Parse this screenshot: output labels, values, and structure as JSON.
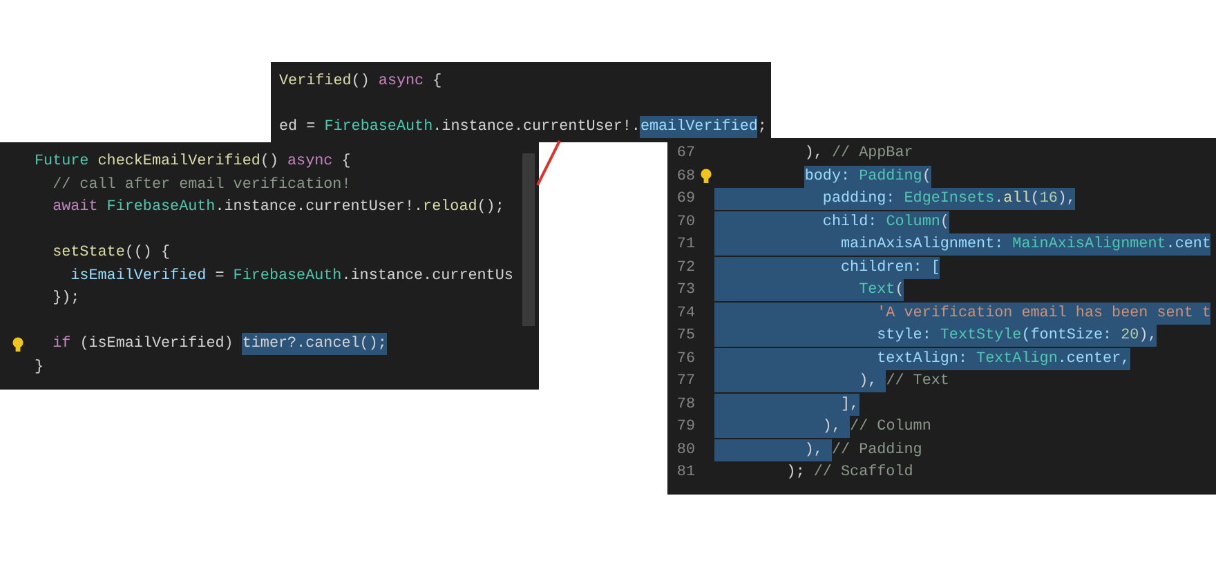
{
  "panels": [
    {
      "kind": "snippet",
      "lines": [
        {
          "bulb": false,
          "tokens": [
            {
              "t": "Verified",
              "kind": "fn",
              "selected": false
            },
            {
              "t": "() ",
              "kind": "plain",
              "selected": false
            },
            {
              "t": "async",
              "kind": "kw",
              "selected": false
            },
            {
              "t": " {",
              "kind": "plain",
              "selected": false
            }
          ]
        },
        {
          "bulb": false
        },
        {
          "bulb": false,
          "tokens": [
            {
              "t": "ed = ",
              "kind": "plain",
              "selected": false
            },
            {
              "t": "FirebaseAuth",
              "kind": "type",
              "selected": false
            },
            {
              "t": ".instance.currentUser!.",
              "kind": "plain",
              "selected": false
            },
            {
              "t": "emailVerified",
              "kind": "var",
              "selected": true
            },
            {
              "t": ";",
              "kind": "plain",
              "selected": false
            }
          ]
        }
      ]
    },
    {
      "kind": "snippet",
      "scrollbar": true,
      "lines": [
        {
          "bulb": false,
          "tokens": [
            {
              "t": "Future",
              "kind": "type",
              "selected": false
            },
            {
              "t": " checkEmailVerified",
              "kind": "fn",
              "selected": false
            },
            {
              "t": "() ",
              "kind": "plain",
              "selected": false
            },
            {
              "t": "async",
              "kind": "kw",
              "selected": false
            },
            {
              "t": " {",
              "kind": "plain",
              "selected": false
            }
          ]
        },
        {
          "bulb": false,
          "tokens": [
            {
              "t": "  // call after email verification!",
              "kind": "comment",
              "selected": false
            }
          ]
        },
        {
          "bulb": false,
          "tokens": [
            {
              "t": "  await",
              "kind": "kw",
              "selected": false
            },
            {
              "t": " FirebaseAuth",
              "kind": "type",
              "selected": false
            },
            {
              "t": ".instance.currentUser!.",
              "kind": "plain",
              "selected": false
            },
            {
              "t": "reload",
              "kind": "fn",
              "selected": false
            },
            {
              "t": "();",
              "kind": "plain",
              "selected": false
            }
          ]
        },
        {
          "bulb": false
        },
        {
          "bulb": false,
          "tokens": [
            {
              "t": "  setState",
              "kind": "fn",
              "selected": false
            },
            {
              "t": "(() {",
              "kind": "plain",
              "selected": false
            }
          ]
        },
        {
          "bulb": false,
          "tokens": [
            {
              "t": "    isEmailVerified",
              "kind": "var",
              "selected": false
            },
            {
              "t": " = ",
              "kind": "plain",
              "selected": false
            },
            {
              "t": "FirebaseAuth",
              "kind": "type",
              "selected": false
            },
            {
              "t": ".instance.currentUs",
              "kind": "plain",
              "selected": false
            }
          ]
        },
        {
          "bulb": false,
          "tokens": [
            {
              "t": "  });",
              "kind": "plain",
              "selected": false
            }
          ]
        },
        {
          "bulb": false
        },
        {
          "bulb": true,
          "tokens": [
            {
              "t": "  if",
              "kind": "kw",
              "selected": false
            },
            {
              "t": " (isEmailVerified) ",
              "kind": "plain",
              "selected": false
            },
            {
              "t": "timer?.cancel();",
              "kind": "plain",
              "selected": true
            }
          ]
        },
        {
          "bulb": false,
          "tokens": [
            {
              "t": "}",
              "kind": "plain",
              "selected": false
            }
          ]
        }
      ]
    },
    {
      "kind": "editor",
      "lines": [
        {
          "number": "67",
          "bulb": false,
          "tokens": [
            {
              "t": "          ), ",
              "kind": "plain",
              "selected": false
            },
            {
              "t": "// AppBar",
              "kind": "comment",
              "selected": false
            }
          ]
        },
        {
          "number": "68",
          "bulb": true,
          "tokens": [
            {
              "t": "          body: ",
              "kind": "var",
              "selected": true
            },
            {
              "t": "Padding",
              "kind": "type",
              "selected": true
            },
            {
              "t": "(",
              "kind": "plain",
              "selected": true
            }
          ]
        },
        {
          "number": "69",
          "bulb": false,
          "tokens": [
            {
              "t": "            padding: ",
              "kind": "var",
              "selected": true
            },
            {
              "t": "EdgeInsets",
              "kind": "type",
              "selected": true
            },
            {
              "t": ".",
              "kind": "plain",
              "selected": true
            },
            {
              "t": "all",
              "kind": "fn",
              "selected": true
            },
            {
              "t": "(",
              "kind": "plain",
              "selected": true
            },
            {
              "t": "16",
              "kind": "num",
              "selected": true
            },
            {
              "t": "),",
              "kind": "plain",
              "selected": true
            }
          ]
        },
        {
          "number": "70",
          "bulb": false,
          "tokens": [
            {
              "t": "            child: ",
              "kind": "var",
              "selected": true
            },
            {
              "t": "Column",
              "kind": "type",
              "selected": true
            },
            {
              "t": "(",
              "kind": "plain",
              "selected": true
            }
          ]
        },
        {
          "number": "71",
          "bulb": false,
          "tokens": [
            {
              "t": "              mainAxisAlignment: ",
              "kind": "var",
              "selected": true
            },
            {
              "t": "MainAxisAlignment",
              "kind": "type",
              "selected": true
            },
            {
              "t": ".cent",
              "kind": "var",
              "selected": true
            }
          ]
        },
        {
          "number": "72",
          "bulb": false,
          "tokens": [
            {
              "t": "              children: [",
              "kind": "var",
              "selected": true
            }
          ]
        },
        {
          "number": "73",
          "bulb": false,
          "tokens": [
            {
              "t": "                Text",
              "kind": "type",
              "selected": true
            },
            {
              "t": "(",
              "kind": "plain",
              "selected": true
            }
          ]
        },
        {
          "number": "74",
          "bulb": false,
          "tokens": [
            {
              "t": "                  'A verification email has been sent t",
              "kind": "str",
              "selected": true
            }
          ]
        },
        {
          "number": "75",
          "bulb": false,
          "tokens": [
            {
              "t": "                  style: ",
              "kind": "var",
              "selected": true
            },
            {
              "t": "TextStyle",
              "kind": "type",
              "selected": true
            },
            {
              "t": "(fontSize: ",
              "kind": "var",
              "selected": true
            },
            {
              "t": "20",
              "kind": "num",
              "selected": true
            },
            {
              "t": "),",
              "kind": "plain",
              "selected": true
            }
          ]
        },
        {
          "number": "76",
          "bulb": false,
          "tokens": [
            {
              "t": "                  textAlign: ",
              "kind": "var",
              "selected": true
            },
            {
              "t": "TextAlign",
              "kind": "type",
              "selected": true
            },
            {
              "t": ".center,",
              "kind": "var",
              "selected": true
            }
          ]
        },
        {
          "number": "77",
          "bulb": false,
          "tokens": [
            {
              "t": "                ), ",
              "kind": "plain",
              "selected": true
            },
            {
              "t": "// Text",
              "kind": "comment",
              "selected": false
            }
          ]
        },
        {
          "number": "78",
          "bulb": false,
          "tokens": [
            {
              "t": "              ],",
              "kind": "plain",
              "selected": true
            }
          ]
        },
        {
          "number": "79",
          "bulb": false,
          "tokens": [
            {
              "t": "            ), ",
              "kind": "plain",
              "selected": true
            },
            {
              "t": "// Column",
              "kind": "comment",
              "selected": false
            }
          ]
        },
        {
          "number": "80",
          "bulb": false,
          "tokens": [
            {
              "t": "          ), ",
              "kind": "plain",
              "selected": true
            },
            {
              "t": "// Padding",
              "kind": "comment",
              "selected": false
            }
          ]
        },
        {
          "number": "81",
          "bulb": false,
          "tokens": [
            {
              "t": "        ); ",
              "kind": "plain",
              "selected": false
            },
            {
              "t": "// Scaffold",
              "kind": "comment",
              "selected": false
            }
          ]
        }
      ]
    }
  ]
}
